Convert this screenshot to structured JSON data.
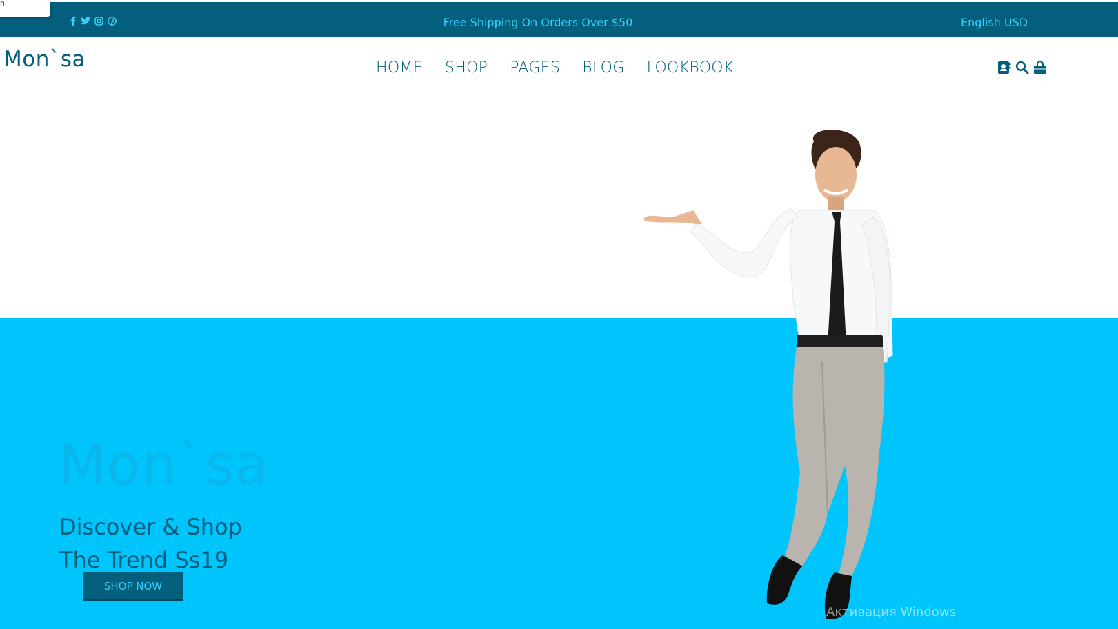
{
  "popup": {
    "label": "п"
  },
  "topbar": {
    "socials": [
      {
        "icon": "facebook-icon"
      },
      {
        "icon": "twitter-icon"
      },
      {
        "icon": "instagram-icon"
      },
      {
        "icon": "pinterest-icon"
      }
    ],
    "announcement": "Free Shipping On Orders Over $50",
    "locale": "English USD"
  },
  "header": {
    "logo": "Mon`sa",
    "nav": [
      {
        "label": "HOME"
      },
      {
        "label": "SHOP"
      },
      {
        "label": "PAGES"
      },
      {
        "label": "BLOG"
      },
      {
        "label": "LOOKBOOK"
      }
    ],
    "icons": [
      "account-icon",
      "search-icon",
      "shopping-bag-icon"
    ]
  },
  "hero": {
    "watermark": "Mon`sa",
    "title_line1": "Discover & Shop",
    "title_line2": "The Trend Ss19",
    "cta": "SHOP NOW"
  },
  "os_overlay": {
    "activate": "Активация Windows"
  },
  "colors": {
    "brand_dark": "#035f7b",
    "accent_cyan": "#00c4fc",
    "announce_text": "#36d0ff"
  }
}
